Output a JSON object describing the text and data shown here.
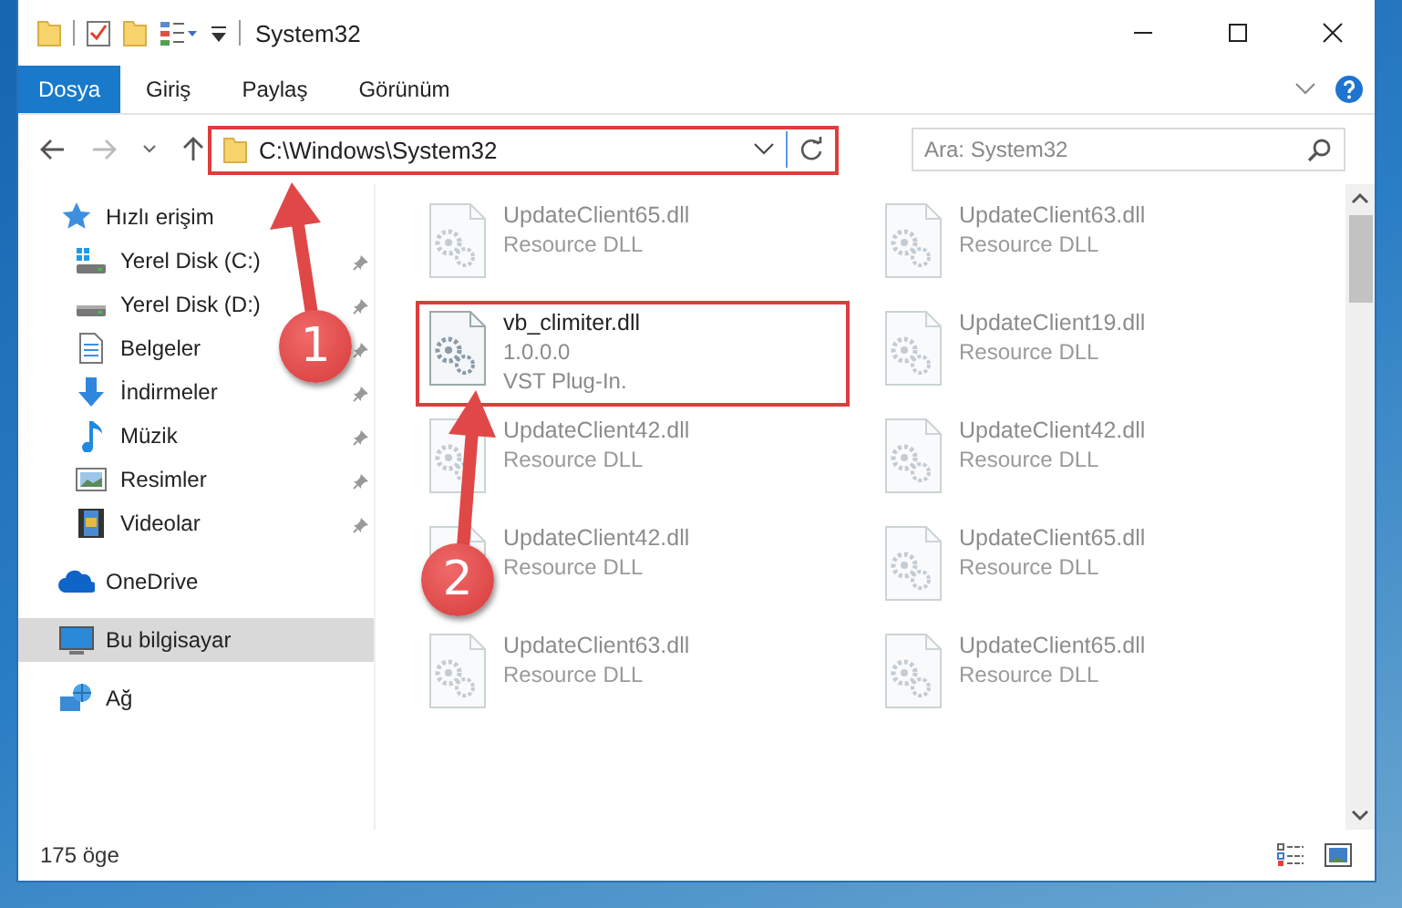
{
  "window": {
    "title": "System32"
  },
  "ribbon": {
    "tabs": [
      {
        "label": "Dosya",
        "selected": true
      },
      {
        "label": "Giriş",
        "selected": false
      },
      {
        "label": "Paylaş",
        "selected": false
      },
      {
        "label": "Görünüm",
        "selected": false
      }
    ]
  },
  "address_bar": {
    "path": "C:\\Windows\\System32",
    "highlighted": true,
    "search": {
      "placeholder": "Ara: System32"
    }
  },
  "nav_pane": {
    "items": [
      {
        "label": "Hızlı erişim",
        "kind": "star",
        "selected": false,
        "children": [
          {
            "label": "Yerel Disk (C:)",
            "kind": "drive-windows",
            "pinned": true,
            "selected": false
          },
          {
            "label": "Yerel Disk (D:)",
            "kind": "drive",
            "pinned": true,
            "selected": false
          },
          {
            "label": "Belgeler",
            "kind": "document",
            "pinned": true,
            "selected": false
          },
          {
            "label": "İndirmeler",
            "kind": "download",
            "pinned": true,
            "selected": false
          },
          {
            "label": "Müzik",
            "kind": "music",
            "pinned": true,
            "selected": false
          },
          {
            "label": "Resimler",
            "kind": "pictures",
            "pinned": true,
            "selected": false
          },
          {
            "label": "Videolar",
            "kind": "videos",
            "pinned": true,
            "selected": false
          }
        ]
      },
      {
        "label": "OneDrive",
        "kind": "cloud",
        "selected": false
      },
      {
        "label": "Bu bilgisayar",
        "kind": "computer",
        "selected": true
      },
      {
        "label": "Ağ",
        "kind": "network",
        "selected": false
      }
    ]
  },
  "files": [
    {
      "name": "UpdateClient65.dll",
      "details": [
        "Resource DLL"
      ],
      "blurred": true,
      "highlighted": false
    },
    {
      "name": "UpdateClient63.dll",
      "details": [
        "Resource DLL"
      ],
      "blurred": true,
      "highlighted": false
    },
    {
      "name": "vb_climiter.dll",
      "details": [
        "1.0.0.0",
        "VST Plug-In."
      ],
      "blurred": false,
      "highlighted": true
    },
    {
      "name": "UpdateClient19.dll",
      "details": [
        "Resource DLL"
      ],
      "blurred": true,
      "highlighted": false
    },
    {
      "name": "UpdateClient42.dll",
      "details": [
        "Resource DLL"
      ],
      "blurred": true,
      "highlighted": false
    },
    {
      "name": "UpdateClient42.dll",
      "details": [
        "Resource DLL"
      ],
      "blurred": true,
      "highlighted": false
    },
    {
      "name": "UpdateClient42.dll",
      "details": [
        "Resource DLL"
      ],
      "blurred": true,
      "highlighted": false
    },
    {
      "name": "UpdateClient65.dll",
      "details": [
        "Resource DLL"
      ],
      "blurred": true,
      "highlighted": false
    },
    {
      "name": "UpdateClient63.dll",
      "details": [
        "Resource DLL"
      ],
      "blurred": true,
      "highlighted": false
    },
    {
      "name": "UpdateClient65.dll",
      "details": [
        "Resource DLL"
      ],
      "blurred": true,
      "highlighted": false
    }
  ],
  "status_bar": {
    "item_count": "175 öge"
  },
  "callouts": [
    {
      "number": "1"
    },
    {
      "number": "2"
    }
  ]
}
